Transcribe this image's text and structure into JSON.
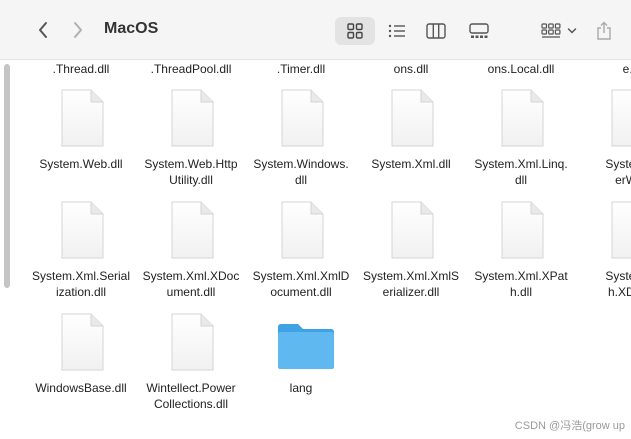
{
  "window": {
    "title": "MacOS"
  },
  "toolbar": {
    "back_icon": "chevron-left-icon",
    "forward_icon": "chevron-right-icon",
    "views": [
      "icon-grid-view-icon",
      "list-view-icon",
      "column-view-icon",
      "gallery-view-icon"
    ],
    "group_icon": "group-by-icon",
    "share_icon": "share-icon"
  },
  "top_row": [
    ".Thread.dll",
    ".ThreadPool.dll",
    ".Timer.dll",
    "ons.dll",
    "ons.Local.dll",
    "e.d"
  ],
  "files": [
    {
      "name": "System.Web.dll"
    },
    {
      "name": "System.Web.Http\nUtility.dll"
    },
    {
      "name": "System.Windows.\ndll"
    },
    {
      "name": "System.Xml.dll"
    },
    {
      "name": "System.Xml.Linq.\ndll"
    },
    {
      "name": "System.X\nerWrit"
    },
    {
      "name": "System.Xml.Serial\nization.dll"
    },
    {
      "name": "System.Xml.XDoc\nument.dll"
    },
    {
      "name": "System.Xml.XmlD\nocument.dll"
    },
    {
      "name": "System.Xml.XmlS\nerializer.dll"
    },
    {
      "name": "System.Xml.XPat\nh.dll"
    },
    {
      "name": "System.X\nh.XDocu"
    },
    {
      "name": "WindowsBase.dll"
    },
    {
      "name": "Wintellect.Power\nCollections.dll"
    },
    {
      "name": "lang",
      "kind": "folder"
    }
  ],
  "colors": {
    "folder": "#5fb8f0",
    "folder_tab": "#3fa2e4"
  },
  "watermark": "CSDN @冯浩(grow up"
}
